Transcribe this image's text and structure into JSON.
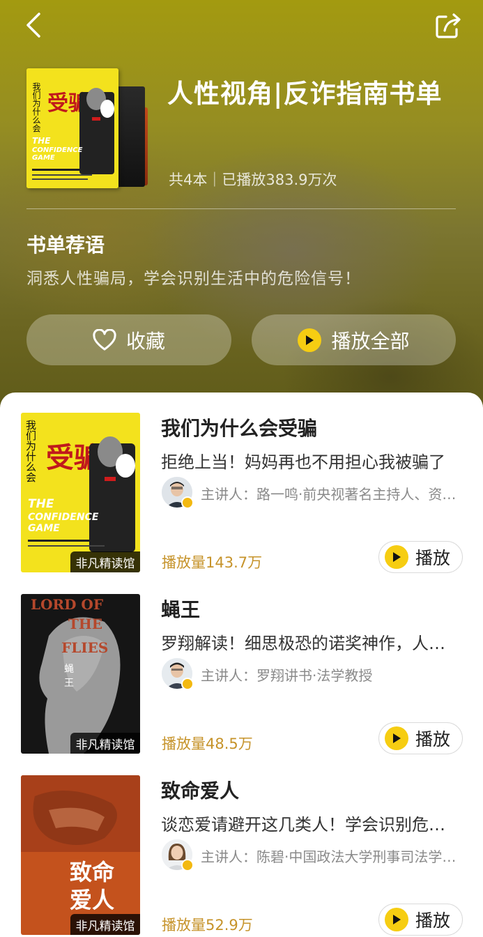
{
  "header": {
    "title": "人性视角|反诈指南书单",
    "meta": "共4本｜已播放383.9万次",
    "back_icon": "back-arrow-icon",
    "share_icon": "share-icon"
  },
  "recommend": {
    "heading": "书单荐语",
    "text": "洞悉人性骗局，学会识别生活中的危险信号！"
  },
  "actions": {
    "favorite_label": "收藏",
    "play_all_label": "播放全部"
  },
  "colors": {
    "accent": "#f6cd12",
    "play_count": "#c6932a"
  },
  "books": [
    {
      "title": "我们为什么会受骗",
      "desc": "拒绝上当！妈妈再也不用担心我被骗了",
      "speaker": "主讲人：路一鸣·前央视著名主持人、资深媒体人",
      "plays": "播放量143.7万",
      "tag": "非凡精读馆",
      "play_label": "播放",
      "cover": {
        "t1": "受骗",
        "t2": "我们为什么会",
        "t3": "THE",
        "t4": "CONFIDENCE",
        "t5": "GAME"
      }
    },
    {
      "title": "蝇王",
      "desc": "罗翔解读！细思极恐的诺奖神作，人性之恶",
      "speaker": "主讲人：罗翔讲书·法学教授",
      "plays": "播放量48.5万",
      "tag": "非凡精读馆",
      "play_label": "播放",
      "cover": {
        "t1": "LORD OF",
        "t2": "THE",
        "t3": "FLIES",
        "t4": "蝇",
        "t5": "王"
      }
    },
    {
      "title": "致命爱人",
      "desc": "谈恋爱请避开这几类人！学会识别危险伴侣",
      "speaker": "主讲人：陈碧·中国政法大学刑事司法学院教授",
      "plays": "播放量52.9万",
      "tag": "非凡精读馆",
      "play_label": "播放",
      "cover": {
        "t1": "致命",
        "t2": "爱人"
      }
    }
  ]
}
